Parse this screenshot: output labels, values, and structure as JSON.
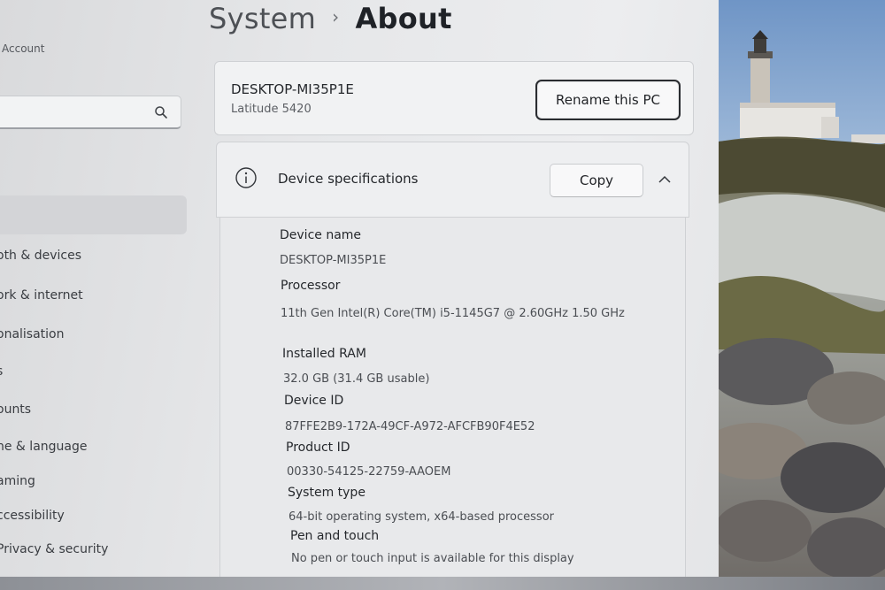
{
  "sidebar": {
    "account_label": "Account",
    "search_placeholder": "",
    "items": [
      {
        "label": "oth & devices"
      },
      {
        "label": "ork & internet"
      },
      {
        "label": "onalisation"
      },
      {
        "label": "s"
      },
      {
        "label": "ounts"
      },
      {
        "label": "ne & language"
      },
      {
        "label": "aming"
      },
      {
        "label": "ccessibility"
      },
      {
        "label": "Privacy & security"
      }
    ]
  },
  "header": {
    "parent": "System",
    "separator": "›",
    "current": "About"
  },
  "pc_card": {
    "name": "DESKTOP-MI35P1E",
    "model": "Latitude 5420",
    "rename_label": "Rename this PC"
  },
  "specs": {
    "title": "Device specifications",
    "copy_label": "Copy",
    "rows": [
      {
        "label": "Device name",
        "value": "DESKTOP-MI35P1E"
      },
      {
        "label": "Processor",
        "value": "11th Gen Intel(R) Core(TM) i5-1145G7 @ 2.60GHz   1.50 GHz"
      },
      {
        "label": "Installed RAM",
        "value": "32.0 GB (31.4 GB usable)"
      },
      {
        "label": "Device ID",
        "value": "87FFE2B9-172A-49CF-A972-AFCFB90F4E52"
      },
      {
        "label": "Product ID",
        "value": "00330-54125-22759-AAOEM"
      },
      {
        "label": "System type",
        "value": "64-bit operating system, x64-based processor"
      },
      {
        "label": "Pen and touch",
        "value": "No pen or touch input is available for this display"
      }
    ]
  },
  "colors": {
    "accent_border": "#2a2c30",
    "card_bg": "#f1f2f3",
    "window_bg": "#e6e7e9"
  }
}
